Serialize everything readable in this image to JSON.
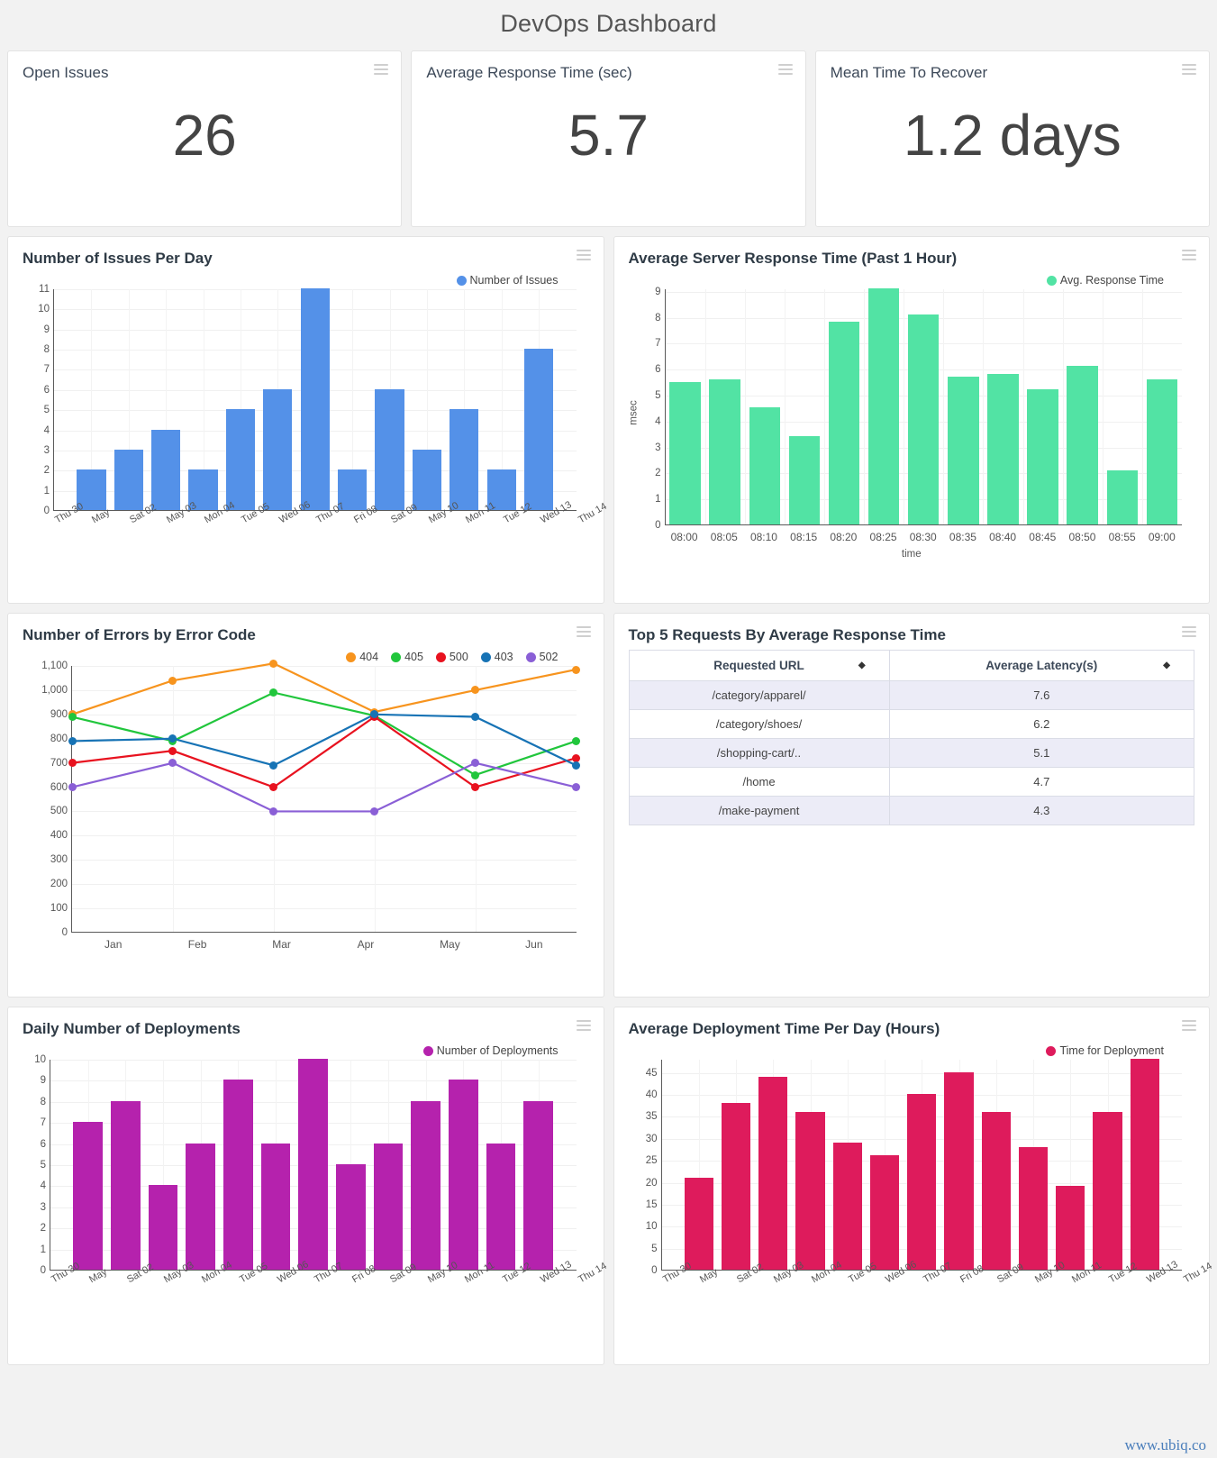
{
  "header": {
    "title": "DevOps Dashboard"
  },
  "icons": {
    "menu": "hamburger-menu-icon",
    "sort": "sort-icon"
  },
  "footer": {
    "watermark": "www.ubiq.co"
  },
  "colors": {
    "blue": "#5491e8",
    "green": "#52e3a4",
    "magenta": "#b522ad",
    "crimson": "#de1b5c",
    "orange": "#f7941e",
    "line_green": "#21c63c",
    "red": "#e8121f",
    "line_blue": "#1773b5",
    "purple": "#8a5fd6"
  },
  "kpis": [
    {
      "title": "Open Issues",
      "value": "26"
    },
    {
      "title": "Average Response Time (sec)",
      "value": "5.7"
    },
    {
      "title": "Mean Time To Recover",
      "value": "1.2 days"
    }
  ],
  "chart_data": [
    {
      "id": "issues_per_day",
      "type": "bar",
      "title": "Number of Issues Per Day",
      "legend": [
        {
          "name": "Number of Issues",
          "color": "#5491e8"
        }
      ],
      "legend_position": "top-right",
      "categories": [
        "May",
        "Sat 02",
        "May 03",
        "Mon 04",
        "Tue 05",
        "Wed 06",
        "Thu 07",
        "Fri 08",
        "Sat 09",
        "May 10",
        "Mon 11",
        "Tue 12",
        "Wed 13"
      ],
      "axis_ticks": [
        "Thu 30",
        "May",
        "Sat 02",
        "May 03",
        "Mon 04",
        "Tue 05",
        "Wed 06",
        "Thu 07",
        "Fri 08",
        "Sat 09",
        "May 10",
        "Mon 11",
        "Tue 12",
        "Wed 13",
        "Thu 14"
      ],
      "values": [
        2,
        3,
        4,
        2,
        5,
        6,
        11,
        2,
        6,
        3,
        5,
        2,
        8
      ],
      "yticks": [
        0,
        1,
        2,
        3,
        4,
        5,
        6,
        7,
        8,
        9,
        10,
        11
      ],
      "ylim": [
        0,
        11
      ],
      "xlabel": "",
      "ylabel": "",
      "grid": true
    },
    {
      "id": "server_response_time",
      "type": "bar",
      "title": "Average Server Response Time (Past 1 Hour)",
      "legend": [
        {
          "name": "Avg. Response Time",
          "color": "#52e3a4"
        }
      ],
      "legend_position": "top-right",
      "categories": [
        "08:00",
        "08:05",
        "08:10",
        "08:15",
        "08:20",
        "08:25",
        "08:30",
        "08:35",
        "08:40",
        "08:45",
        "08:50",
        "08:55",
        "09:00"
      ],
      "values": [
        5.5,
        5.6,
        4.5,
        3.4,
        7.8,
        9.1,
        8.1,
        5.7,
        5.8,
        5.2,
        6.1,
        2.1,
        5.6
      ],
      "yticks": [
        0,
        1,
        2,
        3,
        4,
        5,
        6,
        7,
        8,
        9
      ],
      "ylim": [
        0,
        9.1
      ],
      "xlabel": "time",
      "ylabel": "msec",
      "grid": true
    },
    {
      "id": "errors_by_code",
      "type": "line",
      "title": "Number of Errors by Error Code",
      "legend_position": "top-right",
      "categories": [
        "Jan",
        "Feb",
        "Mar",
        "Apr",
        "May",
        "Jun"
      ],
      "series": [
        {
          "name": "404",
          "color": "#f7941e",
          "values": [
            900,
            1040,
            1110,
            910,
            1000,
            1085
          ]
        },
        {
          "name": "405",
          "color": "#21c63c",
          "values": [
            890,
            790,
            990,
            895,
            650,
            790
          ]
        },
        {
          "name": "500",
          "color": "#e8121f",
          "values": [
            700,
            750,
            600,
            890,
            600,
            720
          ]
        },
        {
          "name": "403",
          "color": "#1773b5",
          "values": [
            790,
            800,
            690,
            900,
            890,
            690
          ]
        },
        {
          "name": "502",
          "color": "#8a5fd6",
          "values": [
            600,
            700,
            500,
            500,
            700,
            600
          ]
        }
      ],
      "yticks": [
        "0",
        "100",
        "200",
        "300",
        "400",
        "500",
        "600",
        "700",
        "800",
        "900",
        "1,000",
        "1,100"
      ],
      "ylim": [
        0,
        1100
      ],
      "xlabel": "",
      "ylabel": "",
      "grid": true
    },
    {
      "id": "daily_deployments",
      "type": "bar",
      "title": "Daily Number of Deployments",
      "legend": [
        {
          "name": "Number of Deployments",
          "color": "#b522ad"
        }
      ],
      "legend_position": "top-right",
      "categories": [
        "May",
        "Sat 02",
        "May 03",
        "Mon 04",
        "Tue 05",
        "Wed 06",
        "Thu 07",
        "Fri 08",
        "Sat 09",
        "May 10",
        "Mon 11",
        "Tue 12",
        "Wed 13"
      ],
      "axis_ticks": [
        "Thu 30",
        "May",
        "Sat 02",
        "May 03",
        "Mon 04",
        "Tue 05",
        "Wed 06",
        "Thu 07",
        "Fri 08",
        "Sat 09",
        "May 10",
        "Mon 11",
        "Tue 12",
        "Wed 13",
        "Thu 14"
      ],
      "values": [
        7,
        8,
        4,
        6,
        9,
        6,
        10,
        5,
        6,
        8,
        9,
        6,
        8
      ],
      "yticks": [
        0,
        1,
        2,
        3,
        4,
        5,
        6,
        7,
        8,
        9,
        10
      ],
      "ylim": [
        0,
        10
      ],
      "xlabel": "",
      "ylabel": "",
      "grid": true
    },
    {
      "id": "deployment_time",
      "type": "bar",
      "title": "Average Deployment Time Per Day (Hours)",
      "legend": [
        {
          "name": "Time for Deployment",
          "color": "#de1b5c"
        }
      ],
      "legend_position": "top-right",
      "categories": [
        "May",
        "Sat 02",
        "May 03",
        "Mon 04",
        "Tue 05",
        "Wed 06",
        "Thu 07",
        "Fri 08",
        "Sat 09",
        "May 10",
        "Mon 11",
        "Tue 12",
        "Wed 13"
      ],
      "axis_ticks": [
        "Thu 30",
        "May",
        "Sat 02",
        "May 03",
        "Mon 04",
        "Tue 05",
        "Wed 06",
        "Thu 07",
        "Fri 08",
        "Sat 09",
        "May 10",
        "Mon 11",
        "Tue 12",
        "Wed 13",
        "Thu 14"
      ],
      "values": [
        21,
        38,
        44,
        36,
        29,
        26,
        40,
        45,
        36,
        28,
        19,
        36,
        48
      ],
      "yticks": [
        0,
        5,
        10,
        15,
        20,
        25,
        30,
        35,
        40,
        45
      ],
      "ylim": [
        0,
        48
      ],
      "xlabel": "",
      "ylabel": "",
      "grid": true
    },
    {
      "id": "top_requests",
      "type": "table",
      "title": "Top 5 Requests By Average Response Time",
      "columns": [
        "Requested URL",
        "Average Latency(s)"
      ],
      "rows": [
        [
          "/category/apparel/",
          "7.6"
        ],
        [
          "/category/shoes/",
          "6.2"
        ],
        [
          "/shopping-cart/..",
          "5.1"
        ],
        [
          "/home",
          "4.7"
        ],
        [
          "/make-payment",
          "4.3"
        ]
      ]
    }
  ]
}
